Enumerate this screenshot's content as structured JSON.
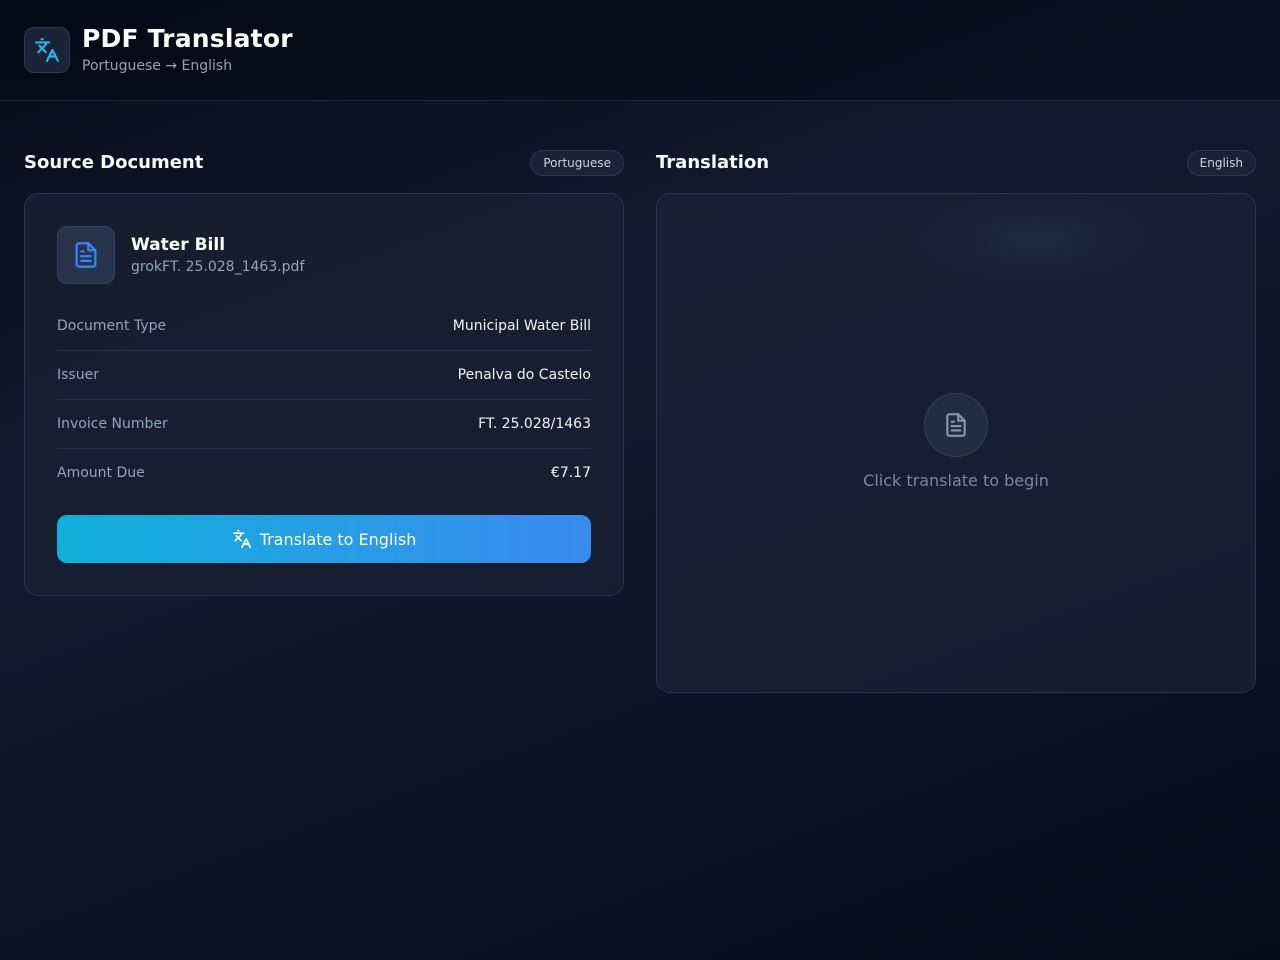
{
  "header": {
    "app_icon": "translate-icon",
    "title": "PDF Translator",
    "subtitle": "Portuguese → English"
  },
  "source": {
    "heading": "Source Document",
    "language_badge": "Portuguese",
    "file": {
      "icon": "document-icon",
      "title": "Water Bill",
      "filename": "grokFT. 25.028_1463.pdf"
    },
    "fields": [
      {
        "label": "Document Type",
        "value": "Municipal Water Bill"
      },
      {
        "label": "Issuer",
        "value": "Penalva do Castelo"
      },
      {
        "label": "Invoice Number",
        "value": "FT. 25.028/1463"
      },
      {
        "label": "Amount Due",
        "value": "€7.17"
      }
    ],
    "translate_button": {
      "icon": "translate-icon",
      "label": "Translate to English"
    }
  },
  "translation": {
    "heading": "Translation",
    "language_badge": "English",
    "empty_state": {
      "icon": "document-icon",
      "message": "Click translate to begin"
    }
  },
  "colors": {
    "accent_start": "#10b0da",
    "accent_end": "#3b8bef",
    "icon_blue": "#3b82f6",
    "icon_cyan": "#22b8e6"
  }
}
